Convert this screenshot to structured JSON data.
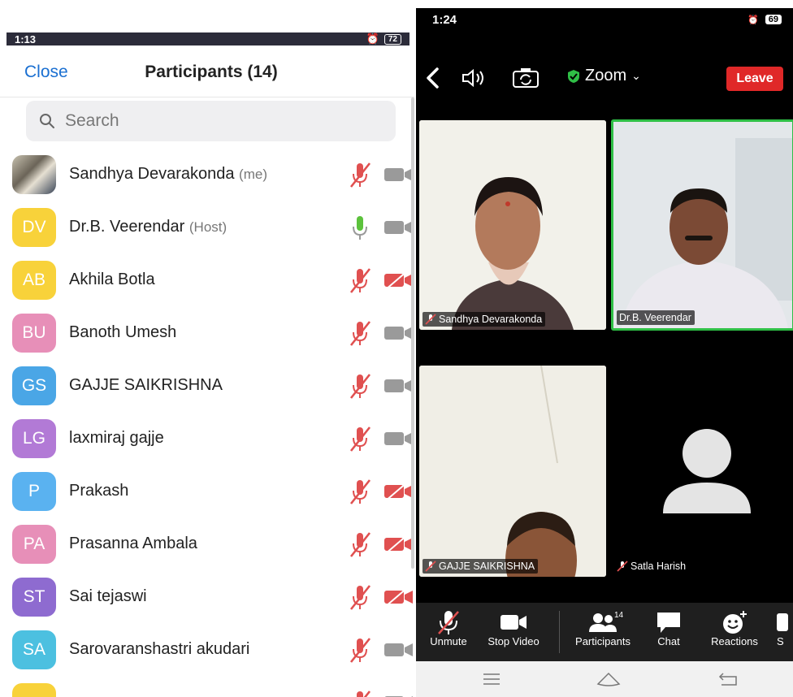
{
  "left": {
    "status": {
      "time": "1:13",
      "battery": "72"
    },
    "close_label": "Close",
    "title": "Participants (14)",
    "search_placeholder": "Search",
    "participants": [
      {
        "initials": "",
        "name": "Sandhya Devarakonda",
        "tag": "(me)",
        "color": "",
        "mic": "muted",
        "cam": "on"
      },
      {
        "initials": "DV",
        "name": "Dr.B. Veerendar",
        "tag": "(Host)",
        "color": "#f8d23a",
        "mic": "active",
        "cam": "on"
      },
      {
        "initials": "AB",
        "name": "Akhila Botla",
        "tag": "",
        "color": "#f8d23a",
        "mic": "muted",
        "cam": "off"
      },
      {
        "initials": "BU",
        "name": "Banoth Umesh",
        "tag": "",
        "color": "#e78fb8",
        "mic": "muted",
        "cam": "on"
      },
      {
        "initials": "GS",
        "name": "GAJJE SAIKRISHNA",
        "tag": "",
        "color": "#4aa6e6",
        "mic": "muted",
        "cam": "on"
      },
      {
        "initials": "LG",
        "name": "laxmiraj gajje",
        "tag": "",
        "color": "#b27ad6",
        "mic": "muted",
        "cam": "on"
      },
      {
        "initials": "P",
        "name": "Prakash",
        "tag": "",
        "color": "#5ab2f0",
        "mic": "muted",
        "cam": "off"
      },
      {
        "initials": "PA",
        "name": "Prasanna Ambala",
        "tag": "",
        "color": "#e78fb8",
        "mic": "muted",
        "cam": "off"
      },
      {
        "initials": "ST",
        "name": "Sai tejaswi",
        "tag": "",
        "color": "#8e6bd0",
        "mic": "muted",
        "cam": "off"
      },
      {
        "initials": "SA",
        "name": "Sarovaranshastri akudari",
        "tag": "",
        "color": "#4cc0e0",
        "mic": "muted",
        "cam": "on"
      },
      {
        "initials": "",
        "name": "",
        "tag": "",
        "color": "#f8d23a",
        "mic": "muted",
        "cam": "on"
      }
    ]
  },
  "right": {
    "status": {
      "time": "1:24",
      "battery": "69"
    },
    "meeting_label": "Zoom",
    "leave_label": "Leave",
    "tiles": [
      {
        "name": "Sandhya Devarakonda",
        "muted": true
      },
      {
        "name": "Dr.B. Veerendar",
        "muted": false
      },
      {
        "name": "GAJJE SAIKRISHNA",
        "muted": true
      },
      {
        "name": "Satla Harish",
        "muted": true
      }
    ],
    "bottom": {
      "unmute": "Unmute",
      "stop_video": "Stop Video",
      "participants": "Participants",
      "participants_count": "14",
      "chat": "Chat",
      "reactions": "Reactions",
      "share_partial": "S"
    }
  },
  "colors": {
    "accent": "#1a6fd1",
    "leave": "#e02828",
    "muted": "#e05050",
    "active_mic": "#5cc23c",
    "active_speaker_border": "#2fbf46"
  }
}
